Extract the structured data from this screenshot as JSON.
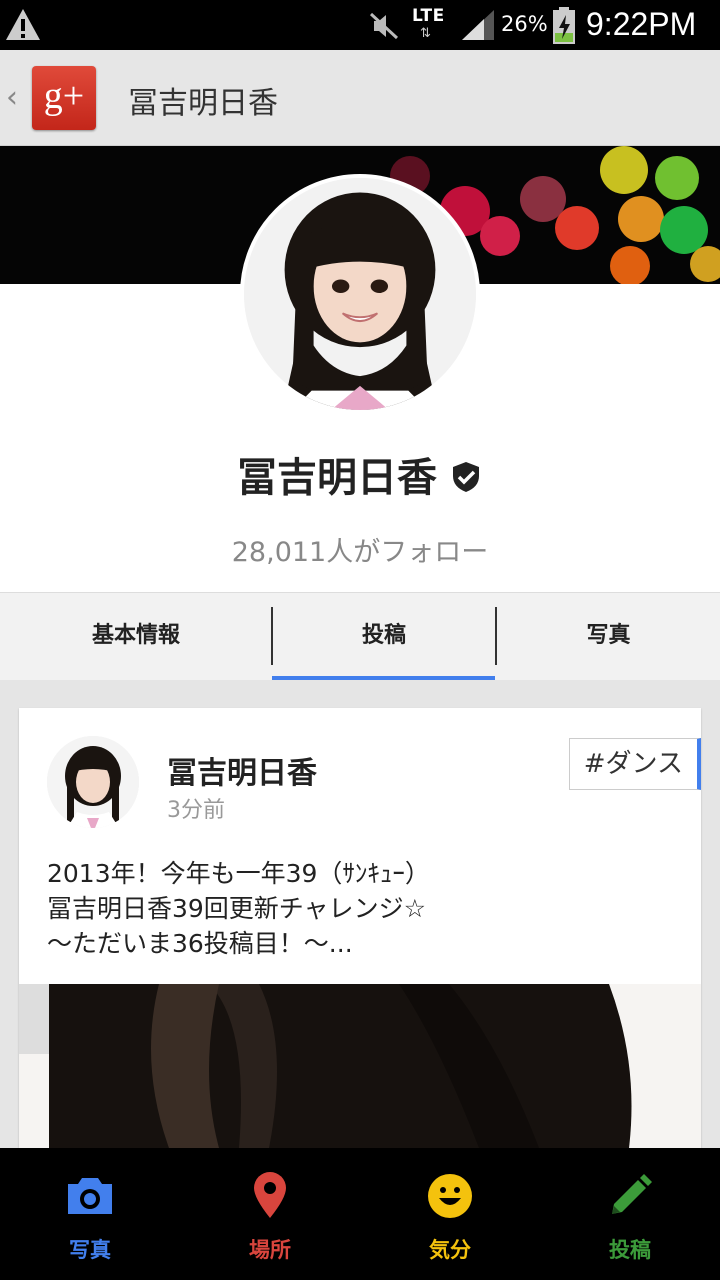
{
  "status_bar": {
    "network": "LTE",
    "battery": "26%",
    "time": "9:22PM"
  },
  "action_bar": {
    "logo_text": "g+",
    "title": "冨吉明日香"
  },
  "profile": {
    "name": "冨吉明日香",
    "followers": "28,011人がフォロー"
  },
  "tabs": [
    {
      "label": "基本情報"
    },
    {
      "label": "投稿",
      "selected": true
    },
    {
      "label": "写真"
    }
  ],
  "post": {
    "author": "冨吉明日香",
    "time": "3分前",
    "hashtag": "#ダンス",
    "lines": [
      "2013年！今年も一年39（ｻﾝｷｭｰ）",
      "冨吉明日香39回更新チャレンジ☆",
      "～ただいま36投稿目！～..."
    ]
  },
  "bottom_bar": [
    {
      "label": "写真",
      "icon": "camera-icon",
      "color": "#427fed"
    },
    {
      "label": "場所",
      "icon": "location-pin-icon",
      "color": "#d9453d"
    },
    {
      "label": "気分",
      "icon": "smiley-icon",
      "color": "#f4c20d"
    },
    {
      "label": "投稿",
      "icon": "pencil-icon",
      "color": "#3c9b3a"
    }
  ],
  "colors": {
    "accent": "#427fed",
    "brand_red": "#d9453d"
  }
}
